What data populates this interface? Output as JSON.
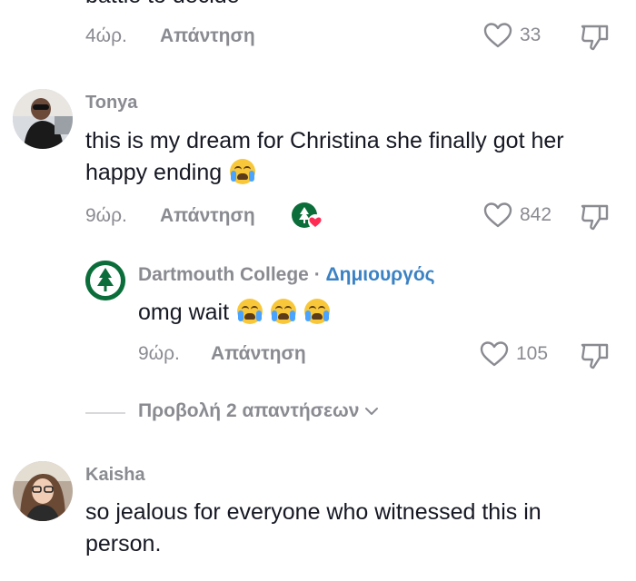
{
  "comment_top": {
    "partial_text": "battle to decide",
    "time": "4ώρ.",
    "reply_label": "Απάντηση",
    "likes": "33"
  },
  "comment_tonya": {
    "username": "Tonya",
    "text": "this is my dream for Christina she finally got her happy ending",
    "time": "9ώρ.",
    "reply_label": "Απάντηση",
    "likes": "842"
  },
  "reply_dartmouth": {
    "username": "Dartmouth College",
    "separator": "·",
    "creator_badge": "Δημιουργός",
    "text": "omg wait",
    "time": "9ώρ.",
    "reply_label": "Απάντηση",
    "likes": "105"
  },
  "view_replies": {
    "label": "Προβολή 2 απαντήσεων"
  },
  "comment_kaisha": {
    "username": "Kaisha",
    "text": "so jealous for everyone who witnessed this in person."
  },
  "colors": {
    "creator_badge": "#3b82c4",
    "meta_gray": "#8a8b91",
    "dartmouth_green": "#0b6e3a"
  }
}
